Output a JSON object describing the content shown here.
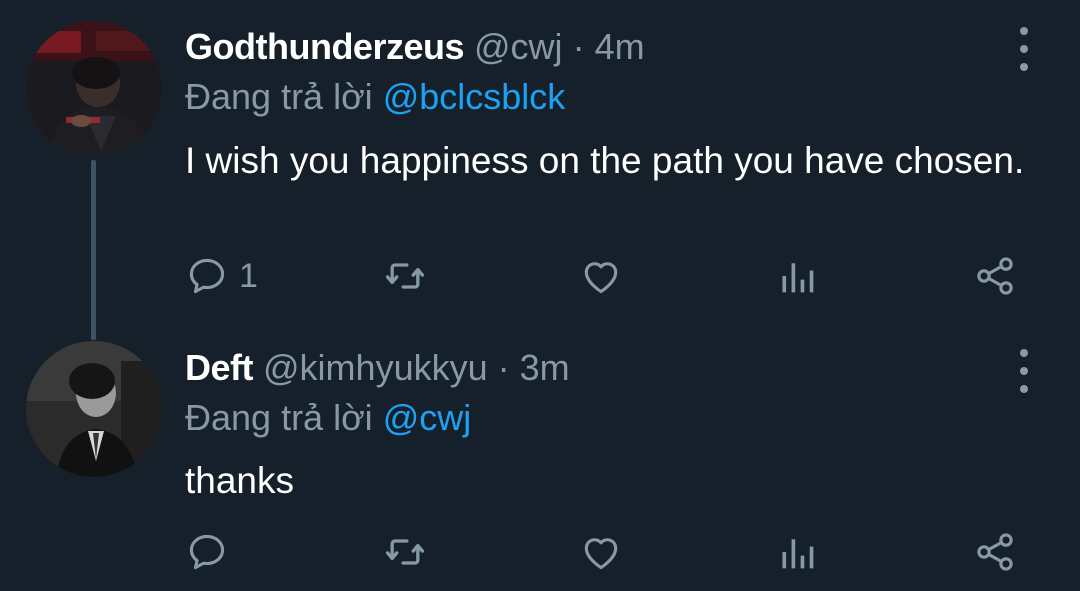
{
  "colors": {
    "background": "#15202b",
    "text": "#ffffff",
    "secondary": "#8899a6",
    "mention": "#1da1f2",
    "thread_line": "#3d5466"
  },
  "tweets": [
    {
      "name": "Godthunderzeus",
      "handle": "@cwj",
      "separator": "·",
      "time": "4m",
      "reply_prefix": "Đang trả lời",
      "reply_to": "@bclcsblck",
      "text": "I wish you happiness on the path you have chosen.",
      "reply_count": "1",
      "icons": [
        "reply-icon",
        "retweet-icon",
        "like-icon",
        "analytics-icon",
        "share-icon",
        "more-icon"
      ]
    },
    {
      "name": "Deft",
      "handle": "@kimhyukkyu",
      "separator": "·",
      "time": "3m",
      "reply_prefix": "Đang trả lời",
      "reply_to": "@cwj",
      "text": "thanks",
      "reply_count": "",
      "icons": [
        "reply-icon",
        "retweet-icon",
        "like-icon",
        "analytics-icon",
        "share-icon",
        "more-icon"
      ]
    }
  ]
}
